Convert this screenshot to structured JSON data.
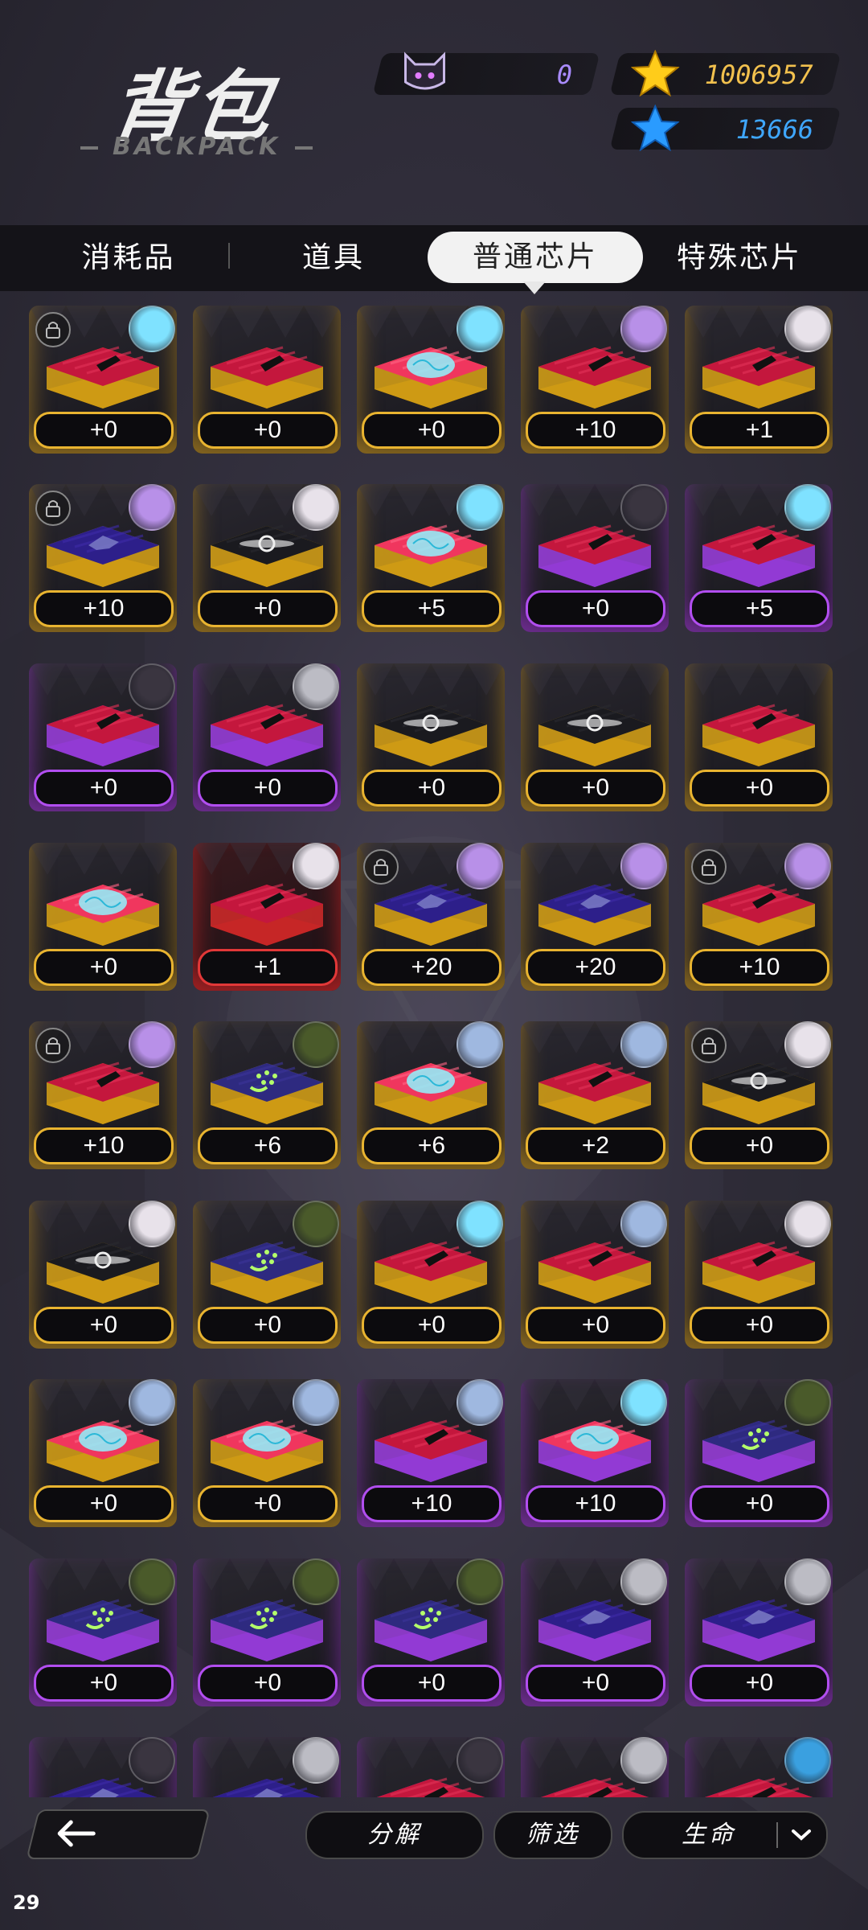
{
  "header": {
    "title": "背包",
    "subtitle": "BACKPACK",
    "currencies": [
      {
        "icon": "cat-mask-icon",
        "value": "0"
      },
      {
        "icon": "gold-star-icon",
        "value": "1006957"
      },
      {
        "icon": "blue-star-icon",
        "value": "13666"
      }
    ]
  },
  "tabs": [
    {
      "label": "消耗品",
      "active": false
    },
    {
      "label": "道具",
      "active": false
    },
    {
      "label": "普通芯片",
      "active": true
    },
    {
      "label": "特殊芯片",
      "active": false
    }
  ],
  "colors": {
    "gold": "#e9b430",
    "purple": "#b24ef0",
    "red": "#e23838",
    "tab_active_bg": "#f2f2f2"
  },
  "grid": {
    "items": [
      {
        "chip": "pen",
        "frame": "gold",
        "level": "+0",
        "locked": true,
        "avatar": "cyan"
      },
      {
        "chip": "pen",
        "frame": "gold",
        "level": "+0",
        "locked": false,
        "avatar": ""
      },
      {
        "chip": "brain",
        "frame": "gold",
        "level": "+0",
        "locked": false,
        "avatar": "cyan"
      },
      {
        "chip": "pen",
        "frame": "gold",
        "level": "+10",
        "locked": false,
        "avatar": "purple"
      },
      {
        "chip": "pen",
        "frame": "gold",
        "level": "+1",
        "locked": false,
        "avatar": "white"
      },
      {
        "chip": "logo",
        "frame": "gold",
        "level": "+10",
        "locked": true,
        "avatar": "purple"
      },
      {
        "chip": "swirl",
        "frame": "gold",
        "level": "+0",
        "locked": false,
        "avatar": "white"
      },
      {
        "chip": "brain",
        "frame": "gold",
        "level": "+5",
        "locked": false,
        "avatar": "cyan"
      },
      {
        "chip": "pen",
        "frame": "purple",
        "level": "+0",
        "locked": false,
        "avatar": "dark"
      },
      {
        "chip": "pen",
        "frame": "purple",
        "level": "+5",
        "locked": false,
        "avatar": "cyan"
      },
      {
        "chip": "pen",
        "frame": "purple",
        "level": "+0",
        "locked": false,
        "avatar": "dark"
      },
      {
        "chip": "pen",
        "frame": "purple",
        "level": "+0",
        "locked": false,
        "avatar": "gray"
      },
      {
        "chip": "swirl",
        "frame": "gold",
        "level": "+0",
        "locked": false,
        "avatar": ""
      },
      {
        "chip": "swirl",
        "frame": "gold",
        "level": "+0",
        "locked": false,
        "avatar": ""
      },
      {
        "chip": "pen",
        "frame": "gold",
        "level": "+0",
        "locked": false,
        "avatar": ""
      },
      {
        "chip": "brain",
        "frame": "gold",
        "level": "+0",
        "locked": false,
        "avatar": ""
      },
      {
        "chip": "pen",
        "frame": "red",
        "level": "+1",
        "locked": false,
        "avatar": "white"
      },
      {
        "chip": "logo",
        "frame": "gold",
        "level": "+20",
        "locked": true,
        "avatar": "purple"
      },
      {
        "chip": "logo",
        "frame": "gold",
        "level": "+20",
        "locked": false,
        "avatar": "purple"
      },
      {
        "chip": "pen",
        "frame": "gold",
        "level": "+10",
        "locked": true,
        "avatar": "purple"
      },
      {
        "chip": "pen",
        "frame": "gold",
        "level": "+10",
        "locked": true,
        "avatar": "purple"
      },
      {
        "chip": "dots",
        "frame": "gold",
        "level": "+6",
        "locked": false,
        "avatar": "green"
      },
      {
        "chip": "brain",
        "frame": "gold",
        "level": "+6",
        "locked": false,
        "avatar": "blue"
      },
      {
        "chip": "pen",
        "frame": "gold",
        "level": "+2",
        "locked": false,
        "avatar": "blue"
      },
      {
        "chip": "swirl",
        "frame": "gold",
        "level": "+0",
        "locked": true,
        "avatar": "white"
      },
      {
        "chip": "swirl",
        "frame": "gold",
        "level": "+0",
        "locked": false,
        "avatar": "white"
      },
      {
        "chip": "dots",
        "frame": "gold",
        "level": "+0",
        "locked": false,
        "avatar": "green"
      },
      {
        "chip": "pen",
        "frame": "gold",
        "level": "+0",
        "locked": false,
        "avatar": "cyan"
      },
      {
        "chip": "pen",
        "frame": "gold",
        "level": "+0",
        "locked": false,
        "avatar": "blue"
      },
      {
        "chip": "pen",
        "frame": "gold",
        "level": "+0",
        "locked": false,
        "avatar": "white"
      },
      {
        "chip": "brain",
        "frame": "gold",
        "level": "+0",
        "locked": false,
        "avatar": "blue"
      },
      {
        "chip": "brain",
        "frame": "gold",
        "level": "+0",
        "locked": false,
        "avatar": "blue"
      },
      {
        "chip": "pen",
        "frame": "purple",
        "level": "+10",
        "locked": false,
        "avatar": "blue"
      },
      {
        "chip": "brain",
        "frame": "purple",
        "level": "+10",
        "locked": false,
        "avatar": "cyan"
      },
      {
        "chip": "dots",
        "frame": "purple",
        "level": "+0",
        "locked": false,
        "avatar": "green"
      },
      {
        "chip": "dots",
        "frame": "purple",
        "level": "+0",
        "locked": false,
        "avatar": "green"
      },
      {
        "chip": "dots",
        "frame": "purple",
        "level": "+0",
        "locked": false,
        "avatar": "green"
      },
      {
        "chip": "dots",
        "frame": "purple",
        "level": "+0",
        "locked": false,
        "avatar": "green"
      },
      {
        "chip": "logo",
        "frame": "purple",
        "level": "+0",
        "locked": false,
        "avatar": "gray"
      },
      {
        "chip": "logo",
        "frame": "purple",
        "level": "+0",
        "locked": false,
        "avatar": "gray"
      },
      {
        "chip": "logo",
        "frame": "purple",
        "level": "",
        "locked": false,
        "avatar": "dark"
      },
      {
        "chip": "logo",
        "frame": "purple",
        "level": "",
        "locked": false,
        "avatar": "gray"
      },
      {
        "chip": "pen",
        "frame": "purple",
        "level": "",
        "locked": false,
        "avatar": "dark"
      },
      {
        "chip": "pen",
        "frame": "purple",
        "level": "",
        "locked": false,
        "avatar": "gray"
      },
      {
        "chip": "pen",
        "frame": "purple",
        "level": "",
        "locked": false,
        "avatar": "ocean"
      }
    ]
  },
  "bottom": {
    "back_icon": "arrow-left-icon",
    "decompose_label": "分解",
    "filter_label": "筛选",
    "sort_label": "生命",
    "sort_icon": "chevron-down-icon"
  },
  "footer": {
    "number": "29"
  }
}
